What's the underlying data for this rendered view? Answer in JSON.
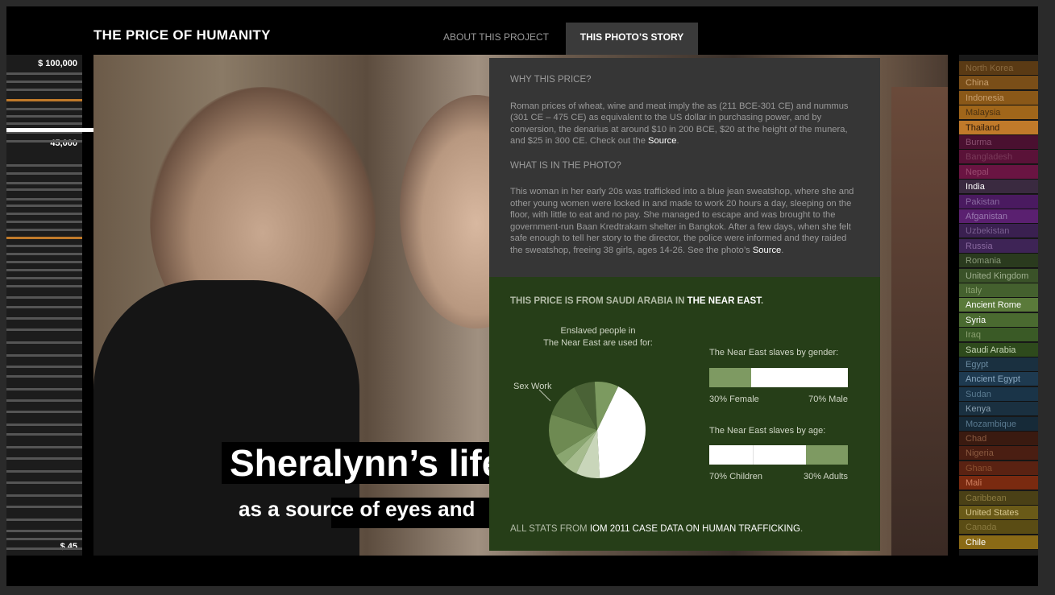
{
  "header": {
    "site_title": "THE PRICE OF HUMANITY",
    "tabs": [
      {
        "label": "ABOUT THIS PROJECT",
        "active": false
      },
      {
        "label": "THIS PHOTO’S STORY",
        "active": true
      }
    ]
  },
  "price_scale": {
    "top_label": "$ 100,000",
    "current_label": "45,000",
    "bottom_label": "$ 45",
    "highlight_color": "#c07a2a"
  },
  "photo": {
    "headline": "Sheralynn’s life",
    "subline": "as a source of eyes and"
  },
  "info": {
    "why_title": "WHY THIS PRICE?",
    "why_text": "Roman prices of wheat, wine and meat imply the as (211 BCE-301 CE) and nummus (301 CE – 475 CE) as equivalent to the US dollar in purchasing power, and by conversion, the denarius at around $10 in 200 BCE, $20 at the height of the munera, and $25 in 300 CE. Check out the",
    "why_link": "Source",
    "what_title": "WHAT IS IN THE PHOTO?",
    "what_text": "This woman in her early 20s was trafficked into a blue jean sweatshop, where she and other young women were locked in and made to work 20 hours a day, sleeping on the floor, with little to eat and no pay. She managed to escape and was brought to the government-run Baan Kredtrakarn shelter in Bangkok. After a few days, when she felt safe enough to tell her story to the director, the police were informed and they raided the sweatshop, freeing 38 girls, ages 14-26. See the photo’s",
    "what_link": "Source",
    "origin_prefix": "THIS PRICE IS FROM SAUDI ARABIA IN",
    "origin_region": "THE NEAR EAST",
    "uses_title_line1": "Enslaved people in",
    "uses_title_line2": "The Near East are used for:",
    "pie_label": "Sex Work",
    "gender_title": "The Near East slaves by gender:",
    "female_label": "30% Female",
    "male_label": "70% Male",
    "female_fraction": 0.3,
    "age_title": "The Near East slaves by age:",
    "children_label": "70% Children",
    "adults_label": "30% Adults",
    "adults_fraction": 0.3,
    "stats_prefix": "ALL STATS FROM",
    "stats_link": "IOM 2011 CASE DATA ON HUMAN TRAFFICKING",
    "stats_suffix": "."
  },
  "pie_slices": [
    {
      "fraction": 0.42,
      "color": "#ffffff"
    },
    {
      "fraction": 0.08,
      "color": "#c9d6ba"
    },
    {
      "fraction": 0.05,
      "color": "#a6bc8e"
    },
    {
      "fraction": 0.04,
      "color": "#8aa670"
    },
    {
      "fraction": 0.14,
      "color": "#6e8a52"
    },
    {
      "fraction": 0.12,
      "color": "#55703e"
    },
    {
      "fraction": 0.07,
      "color": "#4a6236"
    },
    {
      "fraction": 0.08,
      "color": "#7c9a60"
    }
  ],
  "countries": [
    {
      "name": "North Korea",
      "color": "#5a3a14",
      "text": "#8a6a40"
    },
    {
      "name": "China",
      "color": "#7a4e18",
      "text": "#c8a070"
    },
    {
      "name": "Indonesia",
      "color": "#8a5818",
      "text": "#c8a070"
    },
    {
      "name": "Malaysia",
      "color": "#a0661a",
      "text": "#4a3010"
    },
    {
      "name": "Thailand",
      "color": "#c07a2a",
      "text": "#2a1808"
    },
    {
      "name": "Burma",
      "color": "#4a1030",
      "text": "#8a5070"
    },
    {
      "name": "Bangladesh",
      "color": "#5a1238",
      "text": "#7a3a5a"
    },
    {
      "name": "Nepal",
      "color": "#6a1442",
      "text": "#9a4a70"
    },
    {
      "name": "India",
      "color": "#3a2a40",
      "text": "#ffffff"
    },
    {
      "name": "Pakistan",
      "color": "#4a1a60",
      "text": "#8a6aa0"
    },
    {
      "name": "Afganistan",
      "color": "#5a2070",
      "text": "#9a7ab0"
    },
    {
      "name": "Uzbekistan",
      "color": "#3a2050",
      "text": "#7a6090"
    },
    {
      "name": "Russia",
      "color": "#3e2456",
      "text": "#8a6aa0"
    },
    {
      "name": "Romania",
      "color": "#2a3a1e",
      "text": "#8a9a7a"
    },
    {
      "name": "United Kingdom",
      "color": "#3a5228",
      "text": "#a0b090"
    },
    {
      "name": "Italy",
      "color": "#44602e",
      "text": "#8aa070"
    },
    {
      "name": "Ancient Rome",
      "color": "#5a7a3a",
      "text": "#ffffff"
    },
    {
      "name": "Syria",
      "color": "#4a6a30",
      "text": "#ffffff"
    },
    {
      "name": "Iraq",
      "color": "#3a5a26",
      "text": "#8aa070"
    },
    {
      "name": "Saudi Arabia",
      "color": "#2e4a1c",
      "text": "#c8d8b8"
    },
    {
      "name": "Egypt",
      "color": "#1a3040",
      "text": "#6a8aa0"
    },
    {
      "name": "Ancient Egypt",
      "color": "#1e3a50",
      "text": "#8aa8c0"
    },
    {
      "name": "Sudan",
      "color": "#1a3448",
      "text": "#5a7a90"
    },
    {
      "name": "Kenya",
      "color": "#1a3040",
      "text": "#8aa0b0"
    },
    {
      "name": "Mozambique",
      "color": "#162a38",
      "text": "#5a7a90"
    },
    {
      "name": "Chad",
      "color": "#3a1a10",
      "text": "#8a5a40"
    },
    {
      "name": "Nigeria",
      "color": "#4a1e12",
      "text": "#8a5a40"
    },
    {
      "name": "Ghana",
      "color": "#5a2212",
      "text": "#8a5030"
    },
    {
      "name": "Mali",
      "color": "#7a2a10",
      "text": "#d08060"
    },
    {
      "name": "Caribbean",
      "color": "#4a4016",
      "text": "#8a7a40"
    },
    {
      "name": "United States",
      "color": "#6a5a18",
      "text": "#d8c890"
    },
    {
      "name": "Canada",
      "color": "#5a4c14",
      "text": "#8a7a40"
    },
    {
      "name": "Chile",
      "color": "#8a6a16",
      "text": "#ffffff"
    }
  ]
}
